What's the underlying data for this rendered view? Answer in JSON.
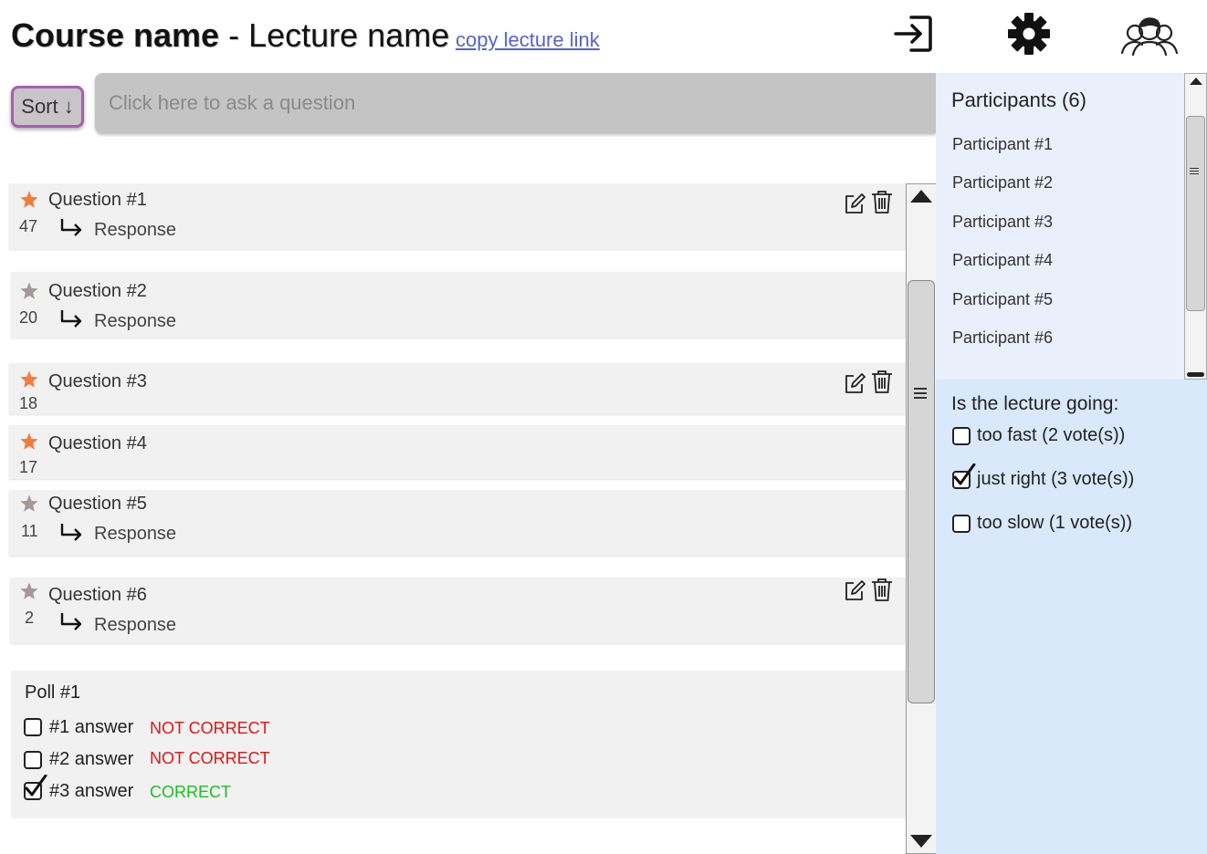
{
  "header": {
    "course": "Course name",
    "separator": " - ",
    "lecture": "Lecture name",
    "copy_link": "copy lecture link",
    "icons": [
      "sign-in-icon",
      "gear-icon",
      "participants-icon"
    ]
  },
  "toolbar": {
    "sort_label": "Sort ↓",
    "ask_placeholder": "Click here to ask a question"
  },
  "questions": [
    {
      "label": "Question #1",
      "votes": "47",
      "starred": true,
      "response": "Response"
    },
    {
      "label": "Question #2",
      "votes": "20",
      "starred": false,
      "response": "Response"
    },
    {
      "label": "Question #3",
      "votes": "18",
      "starred": true,
      "response": ""
    },
    {
      "label": "Question #4",
      "votes": "17",
      "starred": true,
      "response": ""
    },
    {
      "label": "Question #5",
      "votes": "11",
      "starred": false,
      "response": "Response"
    },
    {
      "label": "Question #6",
      "votes": "2",
      "starred": false,
      "response": "Response"
    }
  ],
  "poll": {
    "title": "Poll #1",
    "options": [
      {
        "label": "#1 answer",
        "checked": false,
        "status": "NOT CORRECT"
      },
      {
        "label": "#2 answer",
        "checked": false,
        "status": "NOT CORRECT"
      },
      {
        "label": "#3 answer",
        "checked": true,
        "status": "CORRECT"
      }
    ]
  },
  "participants": {
    "title": "Participants (6)",
    "items": [
      "Participant #1",
      "Participant #2",
      "Participant #3",
      "Participant #4",
      "Participant #5",
      "Participant #6"
    ]
  },
  "pace": {
    "title": "Is the lecture going:",
    "options": [
      {
        "label": "too fast (2 vote(s))",
        "checked": false
      },
      {
        "label": "just right (3 vote(s))",
        "checked": true
      },
      {
        "label": "too slow (1 vote(s))",
        "checked": false
      }
    ]
  },
  "colors": {
    "star_active": "#f47b3a",
    "star_inactive": "#a39a96",
    "not_correct": "#e01515",
    "correct": "#18c21f",
    "link": "#5563c9"
  }
}
